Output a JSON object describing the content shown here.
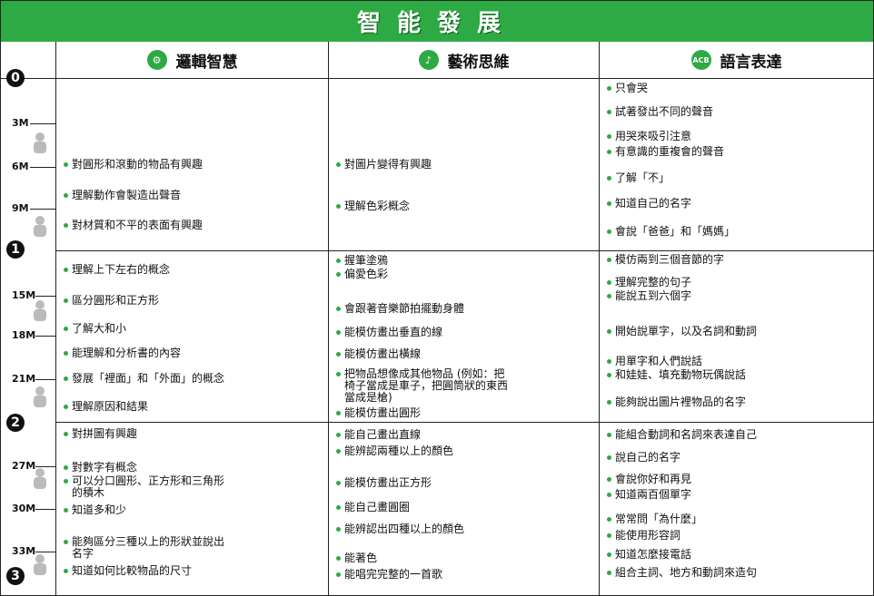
{
  "header": {
    "title": "智能發展"
  },
  "columns": [
    {
      "title": "邏輯智慧",
      "icon": "logic-icon"
    },
    {
      "title": "藝術思維",
      "icon": "art-icon"
    },
    {
      "title": "語言表達",
      "icon": "abc-icon",
      "icon_text": "ACB"
    }
  ],
  "timeline": {
    "years": [
      "0",
      "1",
      "2",
      "3"
    ],
    "months": [
      "3M",
      "6M",
      "9M",
      "15M",
      "18M",
      "21M",
      "27M",
      "30M",
      "33M"
    ]
  },
  "rows": [
    {
      "logic": [
        "對圓形和滾動的物品有興趣",
        "理解動作會製造出聲音",
        "對材質和不平的表面有興趣"
      ],
      "art": [
        "對圖片變得有興趣",
        "理解色彩概念"
      ],
      "language": [
        "只會哭",
        "試著發出不同的聲音",
        "用哭來吸引注意",
        "有意識的重複會的聲音",
        "了解「不」",
        "知道自己的名字",
        "會說「爸爸」和「媽媽」"
      ]
    },
    {
      "logic": [
        "理解上下左右的概念",
        "區分圓形和正方形",
        "了解大和小",
        "能理解和分析書的內容",
        "發展「裡面」和「外面」的概念",
        "理解原因和結果"
      ],
      "art": [
        "握筆塗鴉",
        "偏愛色彩",
        "會跟著音樂節拍擺動身體",
        "能模仿畫出垂直的線",
        "能模仿畫出橫線",
        "把物品想像成其他物品 (例如：把\n椅子當成是車子，把圓筒狀的東西\n當成是槍)",
        "能模仿畫出圓形"
      ],
      "language": [
        "模仿兩到三個音節的字",
        "理解完整的句子",
        "能說五到六個字",
        "開始說單字，以及名詞和動詞",
        "用單字和人們說話",
        "和娃娃、填充動物玩偶說話",
        "能夠說出圖片裡物品的名字"
      ]
    },
    {
      "logic": [
        "對拼圖有興趣",
        "對數字有概念",
        "可以分口圓形、正方形和三角形\n的積木",
        "知道多和少",
        "能夠區分三種以上的形狀並說出\n名字",
        "知道如何比較物品的尺寸"
      ],
      "art": [
        "能自己畫出直線",
        "能辨認兩種以上的顏色",
        "能模仿畫出正方形",
        "能自己畫圓圈",
        "能辨認出四種以上的顏色",
        "能著色",
        "能唱完完整的一首歌"
      ],
      "language": [
        "能組合動詞和名詞來表達自己",
        "說自己的名字",
        "會說你好和再見",
        "知道兩百個單字",
        "常常問「為什麼」",
        "能使用形容詞",
        "知道怎麼接電話",
        "組合主詞、地方和動詞來造句"
      ]
    }
  ]
}
